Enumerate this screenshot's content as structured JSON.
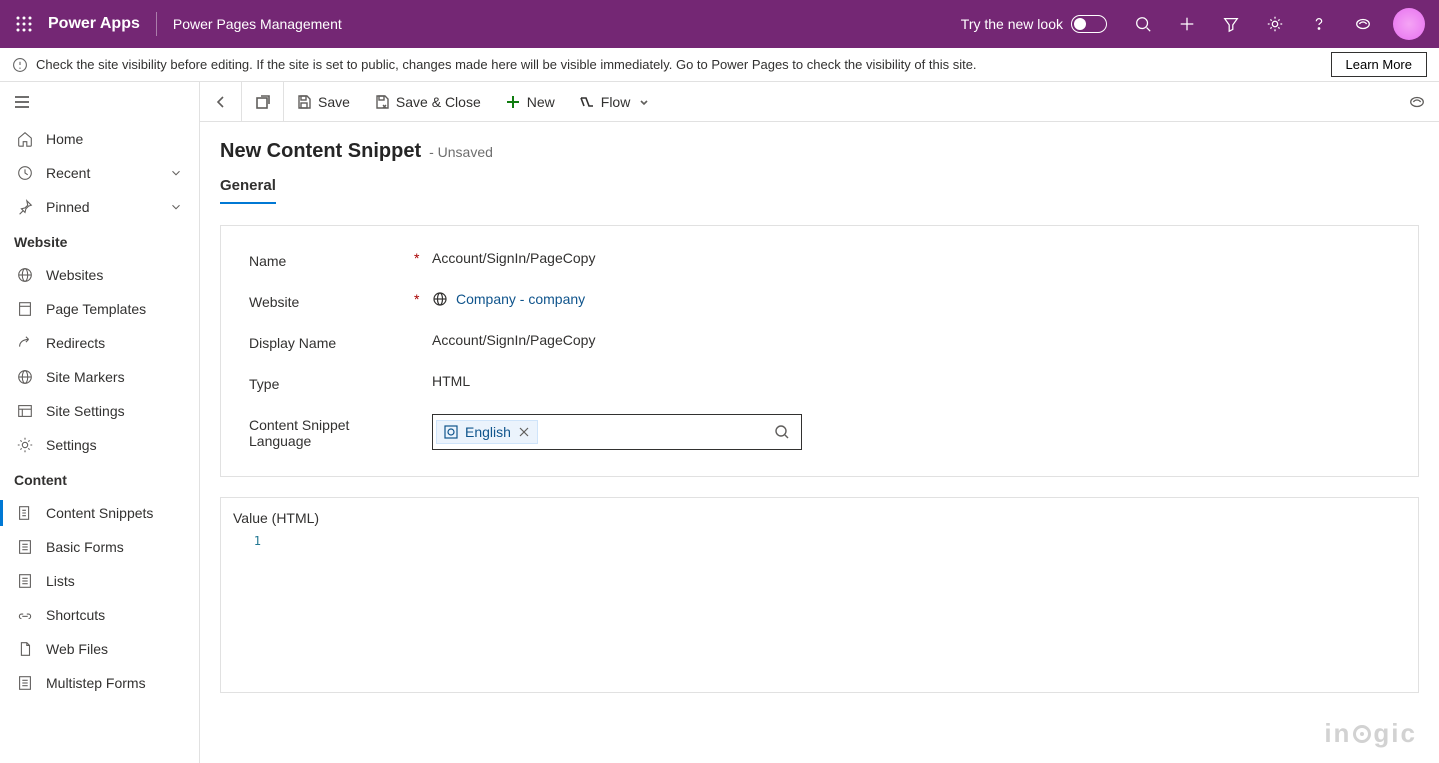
{
  "header": {
    "app_name": "Power Apps",
    "page_name": "Power Pages Management",
    "try_new_look": "Try the new look"
  },
  "notice": {
    "text": "Check the site visibility before editing. If the site is set to public, changes made here will be visible immediately. Go to Power Pages to check the visibility of this site.",
    "learn_more": "Learn More"
  },
  "sidebar": {
    "nav_top": [
      {
        "label": "Home"
      },
      {
        "label": "Recent"
      },
      {
        "label": "Pinned"
      }
    ],
    "section_website": "Website",
    "website_items": [
      {
        "label": "Websites"
      },
      {
        "label": "Page Templates"
      },
      {
        "label": "Redirects"
      },
      {
        "label": "Site Markers"
      },
      {
        "label": "Site Settings"
      },
      {
        "label": "Settings"
      }
    ],
    "section_content": "Content",
    "content_items": [
      {
        "label": "Content Snippets"
      },
      {
        "label": "Basic Forms"
      },
      {
        "label": "Lists"
      },
      {
        "label": "Shortcuts"
      },
      {
        "label": "Web Files"
      },
      {
        "label": "Multistep Forms"
      }
    ]
  },
  "cmdbar": {
    "save": "Save",
    "save_close": "Save & Close",
    "new": "New",
    "flow": "Flow"
  },
  "page": {
    "title": "New Content Snippet",
    "status": "- Unsaved",
    "tab_general": "General"
  },
  "form": {
    "name_label": "Name",
    "name_value": "Account/SignIn/PageCopy",
    "website_label": "Website",
    "website_value": "Company - company",
    "display_name_label": "Display Name",
    "display_name_value": "Account/SignIn/PageCopy",
    "type_label": "Type",
    "type_value": "HTML",
    "language_label": "Content Snippet Language",
    "language_value": "English",
    "value_label": "Value (HTML)",
    "line_1": "1"
  },
  "watermark": "inogic"
}
